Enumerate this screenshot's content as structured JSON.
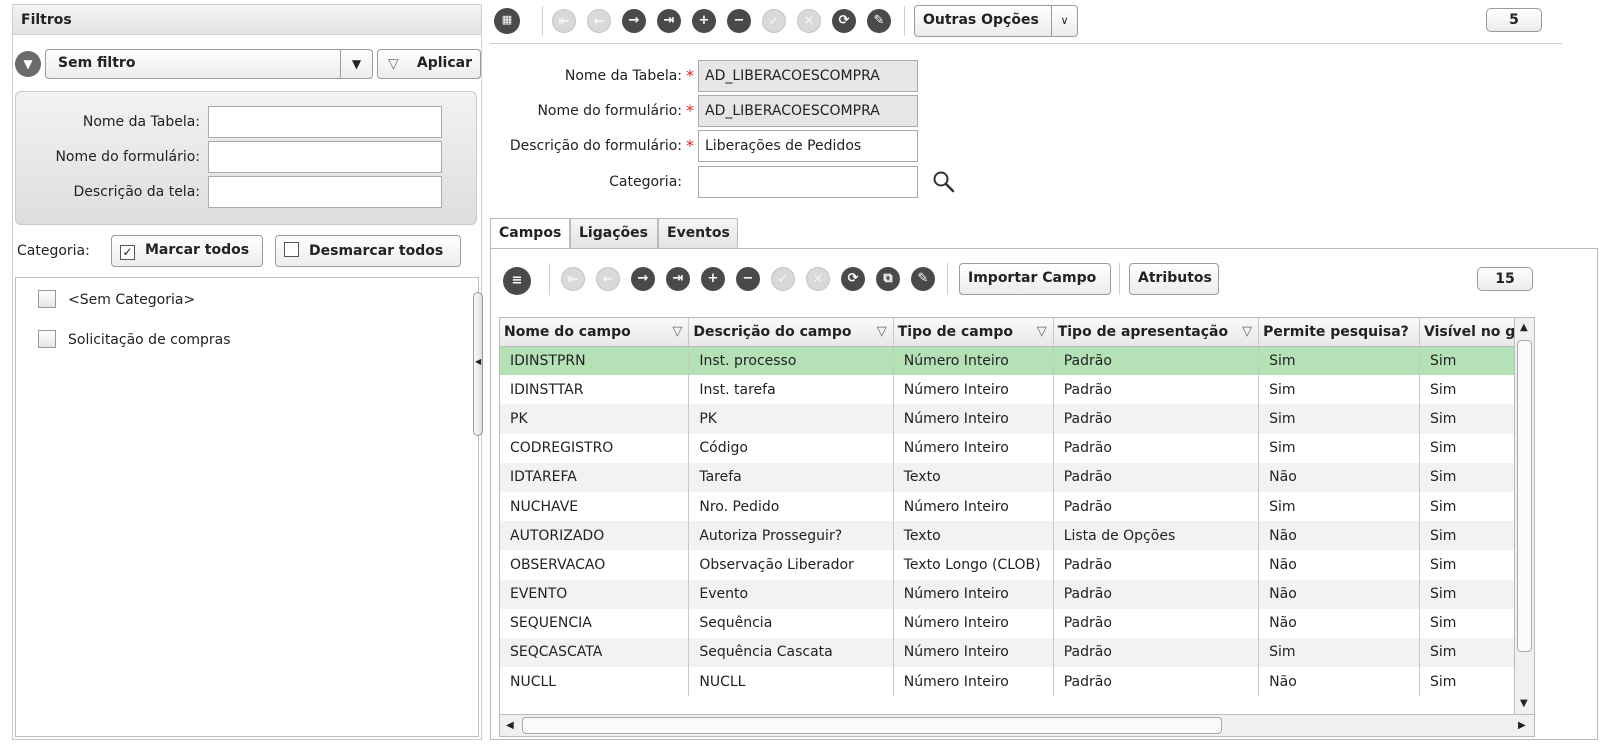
{
  "left_panel": {
    "title": "Filtros",
    "filter_select": "Sem filtro",
    "apply_label": "Aplicar",
    "fields": [
      {
        "label": "Nome da Tabela:",
        "value": ""
      },
      {
        "label": "Nome do formulário:",
        "value": ""
      },
      {
        "label": "Descrição da tela:",
        "value": ""
      }
    ],
    "category_label": "Categoria:",
    "mark_all": "Marcar todos",
    "unmark_all": "Desmarcar todos",
    "categories": [
      "<Sem Categoria>",
      "Solicitação de compras"
    ]
  },
  "top_toolbar": {
    "more_options": "Outras Opções",
    "record_count": "5"
  },
  "form": {
    "table_name_label": "Nome da Tabela:",
    "table_name": "AD_LIBERACOESCOMPRA",
    "form_name_label": "Nome do formulário:",
    "form_name": "AD_LIBERACOESCOMPRA",
    "form_desc_label": "Descrição do formulário:",
    "form_desc": "Liberações de Pedidos",
    "category_label": "Categoria:",
    "category": ""
  },
  "tabs": [
    "Campos",
    "Ligações",
    "Eventos"
  ],
  "grid_toolbar": {
    "import_field": "Importar Campo",
    "attributes": "Atributos",
    "record_count": "15"
  },
  "grid": {
    "columns": [
      "Nome do campo",
      "Descrição do campo",
      "Tipo de campo",
      "Tipo de apresentação",
      "Permite pesquisa?",
      "Visível no gri"
    ],
    "rows": [
      [
        "IDINSTPRN",
        "Inst. processo",
        "Número Inteiro",
        "Padrão",
        "Sim",
        "Sim"
      ],
      [
        "IDINSTTAR",
        "Inst. tarefa",
        "Número Inteiro",
        "Padrão",
        "Sim",
        "Sim"
      ],
      [
        "PK",
        "PK",
        "Número Inteiro",
        "Padrão",
        "Sim",
        "Sim"
      ],
      [
        "CODREGISTRO",
        "Código",
        "Número Inteiro",
        "Padrão",
        "Sim",
        "Sim"
      ],
      [
        "IDTAREFA",
        "Tarefa",
        "Texto",
        "Padrão",
        "Não",
        "Sim"
      ],
      [
        "NUCHAVE",
        "Nro. Pedido",
        "Número Inteiro",
        "Padrão",
        "Sim",
        "Sim"
      ],
      [
        "AUTORIZADO",
        "Autoriza Prosseguir?",
        "Texto",
        "Lista de Opções",
        "Não",
        "Sim"
      ],
      [
        "OBSERVACAO",
        "Observação Liberador",
        "Texto Longo (CLOB)",
        "Padrão",
        "Não",
        "Sim"
      ],
      [
        "EVENTO",
        "Evento",
        "Número Inteiro",
        "Padrão",
        "Não",
        "Sim"
      ],
      [
        "SEQUENCIA",
        "Sequência",
        "Número Inteiro",
        "Padrão",
        "Não",
        "Sim"
      ],
      [
        "SEQCASCATA",
        "Sequência Cascata",
        "Número Inteiro",
        "Padrão",
        "Sim",
        "Sim"
      ],
      [
        "NUCLL",
        "NUCLL",
        "Número Inteiro",
        "Padrão",
        "Não",
        "Sim"
      ]
    ]
  },
  "colors": {
    "selected_row": "#b4e2b6",
    "required": "#dd2222"
  }
}
